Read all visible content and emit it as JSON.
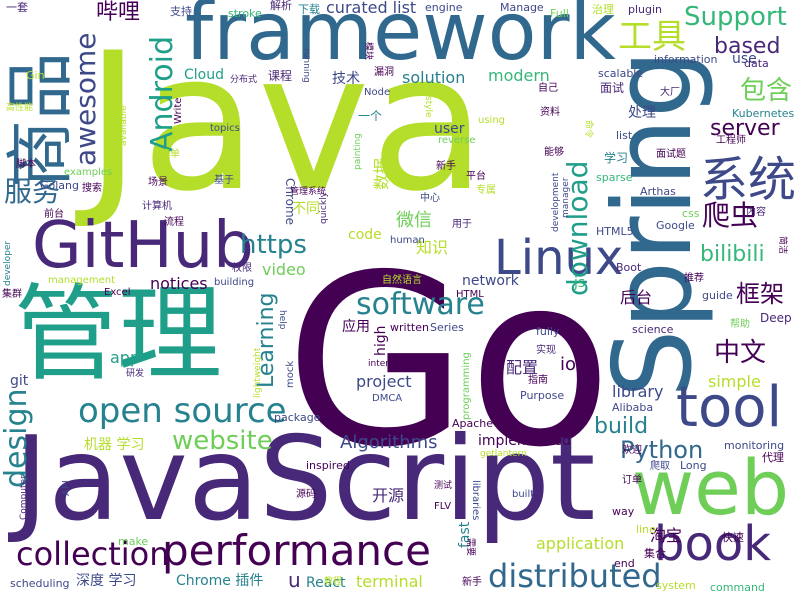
{
  "palette": {
    "dark_purple": "#440154",
    "indigo": "#482878",
    "blue_violet": "#3e4989",
    "steel_blue": "#31688e",
    "teal_blue": "#26828e",
    "teal": "#1f9e89",
    "green": "#35b779",
    "light_green": "#6ece58",
    "yellow_green": "#b5de2b"
  },
  "words": [
    {
      "text": "Go",
      "color": "#440154"
    },
    {
      "text": "Java",
      "color": "#b5de2b"
    },
    {
      "text": "JavaScript",
      "color": "#482878"
    },
    {
      "text": "framework",
      "color": "#31688e"
    },
    {
      "text": "Spring",
      "color": "#31688e"
    },
    {
      "text": "管理",
      "color": "#1f9e89"
    },
    {
      "text": "web",
      "color": "#6ece58"
    },
    {
      "text": "GitHub",
      "color": "#482878"
    },
    {
      "text": "商品",
      "color": "#31688e"
    },
    {
      "text": "Linux",
      "color": "#3e4989"
    },
    {
      "text": "tool",
      "color": "#3e4989"
    },
    {
      "text": "book",
      "color": "#482878"
    },
    {
      "text": "performance",
      "color": "#440154"
    },
    {
      "text": "系统",
      "color": "#3e4989"
    },
    {
      "text": "open source",
      "color": "#26828e"
    },
    {
      "text": "distributed",
      "color": "#31688e"
    },
    {
      "text": "collection",
      "color": "#440154"
    },
    {
      "text": "Android",
      "color": "#1f9e89"
    },
    {
      "text": "software",
      "color": "#26828e"
    },
    {
      "text": "awesome",
      "color": "#3e4989"
    },
    {
      "text": "https",
      "color": "#26828e"
    },
    {
      "text": "website",
      "color": "#6ece58"
    },
    {
      "text": "design",
      "color": "#26828e"
    },
    {
      "text": "Support",
      "color": "#35b779"
    },
    {
      "text": "工具",
      "color": "#b5de2b"
    },
    {
      "text": "服务",
      "color": "#31688e"
    },
    {
      "text": "哔哩",
      "color": "#440154"
    },
    {
      "text": "中文",
      "color": "#440154"
    },
    {
      "text": "爬虫",
      "color": "#440154"
    },
    {
      "text": "包含",
      "color": "#6ece58"
    },
    {
      "text": "框架",
      "color": "#440154"
    },
    {
      "text": "Python",
      "color": "#31688e"
    },
    {
      "text": "download",
      "color": "#1f9e89"
    },
    {
      "text": "bilibili",
      "color": "#35b779"
    },
    {
      "text": "based",
      "color": "#482878"
    },
    {
      "text": "server",
      "color": "#440154"
    },
    {
      "text": "Learning",
      "color": "#26828e"
    },
    {
      "text": "build",
      "color": "#26828e"
    },
    {
      "text": "Algorithms",
      "color": "#3e4989"
    },
    {
      "text": "curated list",
      "color": "#3e4989"
    },
    {
      "text": "application",
      "color": "#b5de2b"
    },
    {
      "text": "terminal",
      "color": "#b5de2b"
    },
    {
      "text": "Chrome 插件",
      "color": "#26828e"
    },
    {
      "text": "深度 学习",
      "color": "#3e4989"
    },
    {
      "text": "notices",
      "color": "#440154"
    },
    {
      "text": "video",
      "color": "#6ece58"
    },
    {
      "text": "solution",
      "color": "#26828e"
    },
    {
      "text": "modern",
      "color": "#35b779"
    },
    {
      "text": "project",
      "color": "#3e4989"
    },
    {
      "text": "library",
      "color": "#3e4989"
    },
    {
      "text": "implemented",
      "color": "#440154"
    },
    {
      "text": "React",
      "color": "#26828e"
    },
    {
      "text": "微信",
      "color": "#6ece58"
    },
    {
      "text": "开源",
      "color": "#482878"
    },
    {
      "text": "知识",
      "color": "#b5de2b"
    },
    {
      "text": "network",
      "color": "#3e4989"
    },
    {
      "text": "后台",
      "color": "#440154"
    },
    {
      "text": "配置",
      "color": "#482878"
    },
    {
      "text": "淘宝",
      "color": "#440154"
    },
    {
      "text": "simple",
      "color": "#b5de2b"
    },
    {
      "text": "Cloud",
      "color": "#1f9e89"
    },
    {
      "text": "Deep",
      "color": "#482878"
    },
    {
      "text": "app",
      "color": "#1f9e89"
    },
    {
      "text": "io",
      "color": "#440154"
    },
    {
      "text": "code",
      "color": "#b5de2b"
    },
    {
      "text": "git",
      "color": "#3e4989"
    },
    {
      "text": "user",
      "color": "#3e4989"
    },
    {
      "text": "fast",
      "color": "#26828e"
    },
    {
      "text": "use",
      "color": "#3e4989"
    },
    {
      "text": "u",
      "color": "#482878"
    },
    {
      "text": "机器 学习",
      "color": "#b5de2b"
    },
    {
      "text": "数据",
      "color": "#b5de2b"
    },
    {
      "text": "处理",
      "color": "#3e4989"
    },
    {
      "text": "应用",
      "color": "#440154"
    },
    {
      "text": "不同",
      "color": "#b5de2b"
    },
    {
      "text": "技术",
      "color": "#3e4989"
    },
    {
      "text": "课程",
      "color": "#482878"
    },
    {
      "text": "一个",
      "color": "#26828e"
    },
    {
      "text": "面试",
      "color": "#482878"
    },
    {
      "text": "学习",
      "color": "#26828e"
    },
    {
      "text": "集合",
      "color": "#440154"
    },
    {
      "text": "快速",
      "color": "#440154"
    },
    {
      "text": "代理",
      "color": "#440154"
    },
    {
      "text": "js",
      "color": "#35b779"
    },
    {
      "text": "high",
      "color": "#440154"
    },
    {
      "text": "Chrome",
      "color": "#3e4989"
    },
    {
      "text": "plugin",
      "color": "#482878"
    },
    {
      "text": "engine",
      "color": "#3e4989"
    },
    {
      "text": "Manage",
      "color": "#3e4989"
    },
    {
      "text": "Full",
      "color": "#6ece58"
    },
    {
      "text": "治理",
      "color": "#b5de2b"
    },
    {
      "text": "下载",
      "color": "#26828e"
    },
    {
      "text": "支持",
      "color": "#3e4989"
    },
    {
      "text": "stroke",
      "color": "#35b779"
    },
    {
      "text": "解析",
      "color": "#482878"
    },
    {
      "text": "一套",
      "color": "#482878"
    },
    {
      "text": "Gin",
      "color": "#b5de2b"
    },
    {
      "text": "scalable",
      "color": "#3e4989"
    },
    {
      "text": "information",
      "color": "#3e4989"
    },
    {
      "text": "data",
      "color": "#482878"
    },
    {
      "text": "Kubernetes",
      "color": "#26828e"
    },
    {
      "text": "工程师",
      "color": "#440154"
    },
    {
      "text": "大厂",
      "color": "#482878"
    },
    {
      "text": "list",
      "color": "#3e4989"
    },
    {
      "text": "面试题",
      "color": "#440154"
    },
    {
      "text": "sparse",
      "color": "#35b779"
    },
    {
      "text": "Arthas",
      "color": "#3e4989"
    },
    {
      "text": "Google",
      "color": "#3e4989"
    },
    {
      "text": "内容",
      "color": "#482878"
    },
    {
      "text": "css",
      "color": "#6ece58"
    },
    {
      "text": "HTML5",
      "color": "#3e4989"
    },
    {
      "text": "Boot",
      "color": "#482878"
    },
    {
      "text": "推荐",
      "color": "#440154"
    },
    {
      "text": "guide",
      "color": "#3e4989"
    },
    {
      "text": "帮助",
      "color": "#6ece58"
    },
    {
      "text": "science",
      "color": "#482878"
    },
    {
      "text": "fully",
      "color": "#3e4989"
    },
    {
      "text": "Series",
      "color": "#3e4989"
    },
    {
      "text": "written",
      "color": "#440154"
    },
    {
      "text": "实现",
      "color": "#482878"
    },
    {
      "text": "指南",
      "color": "#440154"
    },
    {
      "text": "Purpose",
      "color": "#3e4989"
    },
    {
      "text": "Alibaba",
      "color": "#3e4989"
    },
    {
      "text": "monitoring",
      "color": "#3e4989"
    },
    {
      "text": "欢迎",
      "color": "#440154"
    },
    {
      "text": "爬取",
      "color": "#3e4989"
    },
    {
      "text": "Long",
      "color": "#3e4989"
    },
    {
      "text": "订单",
      "color": "#440154"
    },
    {
      "text": "way",
      "color": "#440154"
    },
    {
      "text": "line",
      "color": "#b5de2b"
    },
    {
      "text": "end",
      "color": "#440154"
    },
    {
      "text": "system",
      "color": "#b5de2b"
    },
    {
      "text": "command",
      "color": "#35b779"
    },
    {
      "text": "新手",
      "color": "#440154"
    },
    {
      "text": "教程",
      "color": "#b5de2b"
    },
    {
      "text": "需要",
      "color": "#440154"
    },
    {
      "text": "scheduling",
      "color": "#3e4989"
    },
    {
      "text": "make",
      "color": "#6ece58"
    },
    {
      "text": "Computer",
      "color": "#482878"
    },
    {
      "text": "API",
      "color": "#3e4989"
    },
    {
      "text": "inspired",
      "color": "#440154"
    },
    {
      "text": "源码",
      "color": "#440154"
    },
    {
      "text": "package",
      "color": "#3e4989"
    },
    {
      "text": "mock",
      "color": "#3e4989"
    },
    {
      "text": "getlantern",
      "color": "#b5de2b"
    },
    {
      "text": "Apache",
      "color": "#440154"
    },
    {
      "text": "libraries",
      "color": "#3e4989"
    },
    {
      "text": "built",
      "color": "#3e4989"
    },
    {
      "text": "测试",
      "color": "#440154"
    },
    {
      "text": "FLV",
      "color": "#440154"
    },
    {
      "text": "programming",
      "color": "#6ece58"
    },
    {
      "text": "DMCA",
      "color": "#3e4989"
    },
    {
      "text": "interfaces",
      "color": "#440154"
    },
    {
      "text": "lightweight",
      "color": "#b5de2b"
    },
    {
      "text": "研发",
      "color": "#482878"
    },
    {
      "text": "help",
      "color": "#3e4989"
    },
    {
      "text": "building",
      "color": "#3e4989"
    },
    {
      "text": "Excel",
      "color": "#440154"
    },
    {
      "text": "集群",
      "color": "#440154"
    },
    {
      "text": "developer",
      "color": "#26828e"
    },
    {
      "text": "management",
      "color": "#b5de2b"
    },
    {
      "text": "权限",
      "color": "#482878"
    },
    {
      "text": "HTML",
      "color": "#440154"
    },
    {
      "text": "自然语言",
      "color": "#b5de2b"
    },
    {
      "text": "流程",
      "color": "#440154"
    },
    {
      "text": "计算机",
      "color": "#482878"
    },
    {
      "text": "场景",
      "color": "#440154"
    },
    {
      "text": "搜索",
      "color": "#440154"
    },
    {
      "text": "前台",
      "color": "#440154"
    },
    {
      "text": "examples",
      "color": "#6ece58"
    },
    {
      "text": "Golang",
      "color": "#3e4989"
    },
    {
      "text": "脚本",
      "color": "#440154"
    },
    {
      "text": "简单",
      "color": "#b5de2b"
    },
    {
      "text": "available",
      "color": "#b5de2b"
    },
    {
      "text": "Write",
      "color": "#440154"
    },
    {
      "text": "topics",
      "color": "#3e4989"
    },
    {
      "text": "基于",
      "color": "#3e4989"
    },
    {
      "text": "quickly",
      "color": "#482878"
    },
    {
      "text": "painting",
      "color": "#6ece58"
    },
    {
      "text": "human",
      "color": "#3e4989"
    },
    {
      "text": "用于",
      "color": "#482878"
    },
    {
      "text": "专属",
      "color": "#b5de2b"
    },
    {
      "text": "平台",
      "color": "#440154"
    },
    {
      "text": "中心",
      "color": "#3e4989"
    },
    {
      "text": "管理系统",
      "color": "#440154"
    },
    {
      "text": "reverse",
      "color": "#6ece58"
    },
    {
      "text": "新手",
      "color": "#440154"
    },
    {
      "text": "development",
      "color": "#3e4989"
    },
    {
      "text": "manager",
      "color": "#3e4989"
    },
    {
      "text": "能够",
      "color": "#440154"
    },
    {
      "text": "资料",
      "color": "#440154"
    },
    {
      "text": "命令",
      "color": "#b5de2b"
    },
    {
      "text": "自己",
      "color": "#440154"
    },
    {
      "text": "using",
      "color": "#b5de2b"
    },
    {
      "text": "style",
      "color": "#b5de2b"
    },
    {
      "text": "Node",
      "color": "#3e4989"
    },
    {
      "text": "漏洞",
      "color": "#440154"
    },
    {
      "text": "running",
      "color": "#3e4989"
    },
    {
      "text": "模块",
      "color": "#440154"
    },
    {
      "text": "分布式",
      "color": "#482878"
    },
    {
      "text": "高性能",
      "color": "#b5de2b"
    },
    {
      "text": "简洁",
      "color": "#440154"
    }
  ]
}
